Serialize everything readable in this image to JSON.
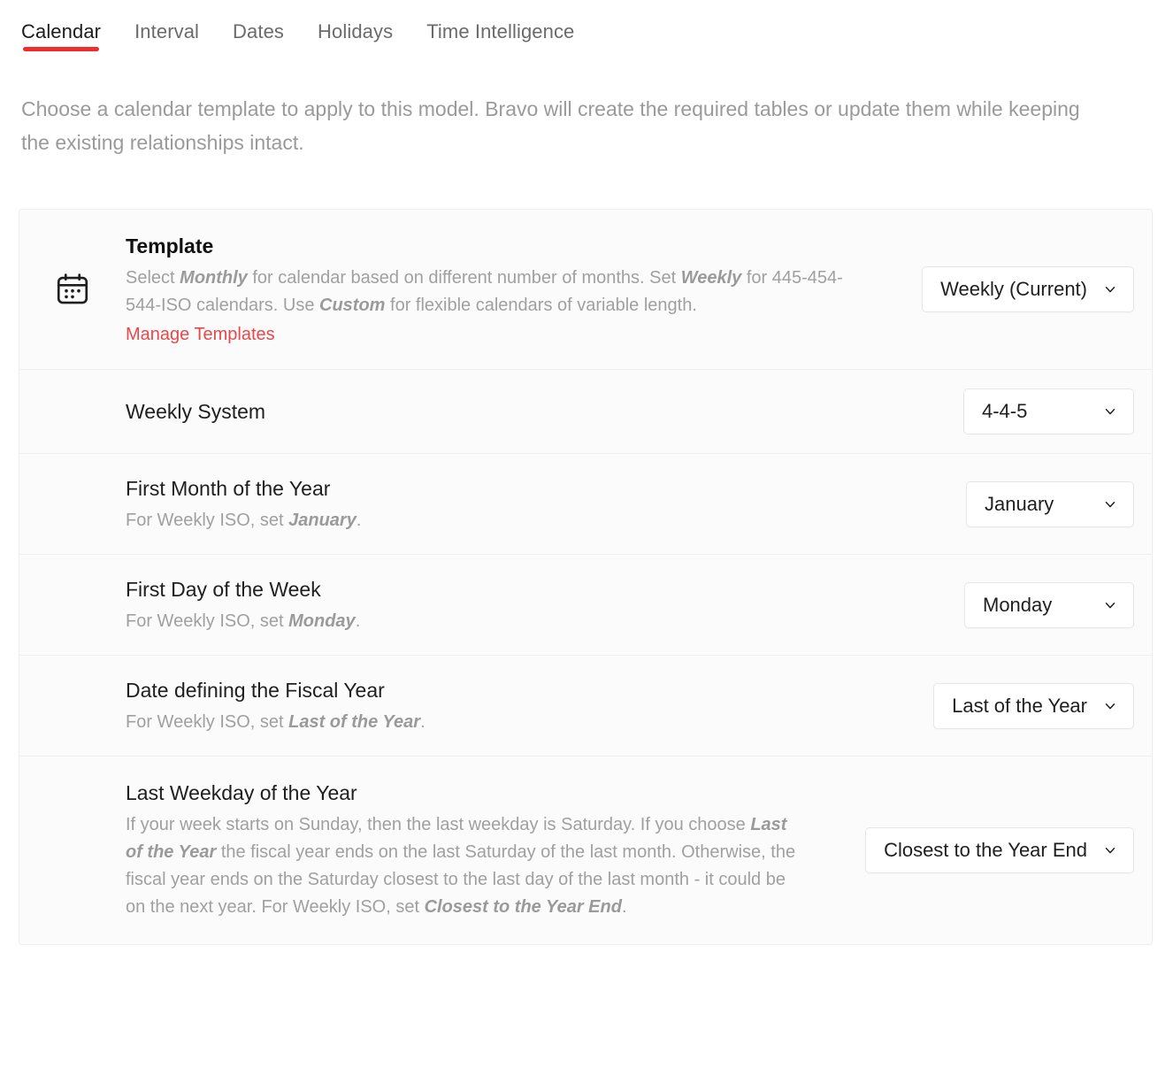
{
  "tabs": [
    {
      "label": "Calendar",
      "active": true
    },
    {
      "label": "Interval",
      "active": false
    },
    {
      "label": "Dates",
      "active": false
    },
    {
      "label": "Holidays",
      "active": false
    },
    {
      "label": "Time Intelligence",
      "active": false
    }
  ],
  "intro": "Choose a calendar template to apply to this model. Bravo will create the required tables or update them while keeping the existing relationships intact.",
  "colors": {
    "accent_red": "#f02c2c",
    "link_red": "#e8484a",
    "card_bg": "#fbfbfb",
    "title_text": "#1f1f1f",
    "muted_text": "#a0a0a0"
  },
  "rows": {
    "template": {
      "icon": "calendar-icon",
      "title": "Template",
      "desc_part1": "Select ",
      "desc_em1": "Monthly",
      "desc_part2": " for calendar based on different number of months. Set ",
      "desc_em2": "Weekly",
      "desc_part3": " for 445-454-544-ISO calendars. Use ",
      "desc_em3": "Custom",
      "desc_part4": " for flexible calendars of variable length.",
      "link": "Manage Templates",
      "value": "Weekly (Current)"
    },
    "weekly_system": {
      "title": "Weekly System",
      "value": "4-4-5"
    },
    "first_month": {
      "title": "First Month of the Year",
      "desc_part1": "For Weekly ISO, set ",
      "desc_em1": "January",
      "desc_part2": ".",
      "value": "January"
    },
    "first_day": {
      "title": "First Day of the Week",
      "desc_part1": "For Weekly ISO, set ",
      "desc_em1": "Monday",
      "desc_part2": ".",
      "value": "Monday"
    },
    "fiscal_year_date": {
      "title": "Date defining the Fiscal Year",
      "desc_part1": "For Weekly ISO, set ",
      "desc_em1": "Last of the Year",
      "desc_part2": ".",
      "value": "Last of the Year"
    },
    "last_weekday": {
      "title": "Last Weekday of the Year",
      "desc_part1": "If your week starts on Sunday, then the last weekday is Saturday. If you choose ",
      "desc_em1": "Last of the Year",
      "desc_part2": " the fiscal year ends on the last Saturday of the last month. Otherwise, the fiscal year ends on the Saturday closest to the last day of the last month - it could be on the next year. For Weekly ISO, set ",
      "desc_em2": "Closest to the Year End",
      "desc_part3": ".",
      "value": "Closest to the Year End"
    }
  }
}
